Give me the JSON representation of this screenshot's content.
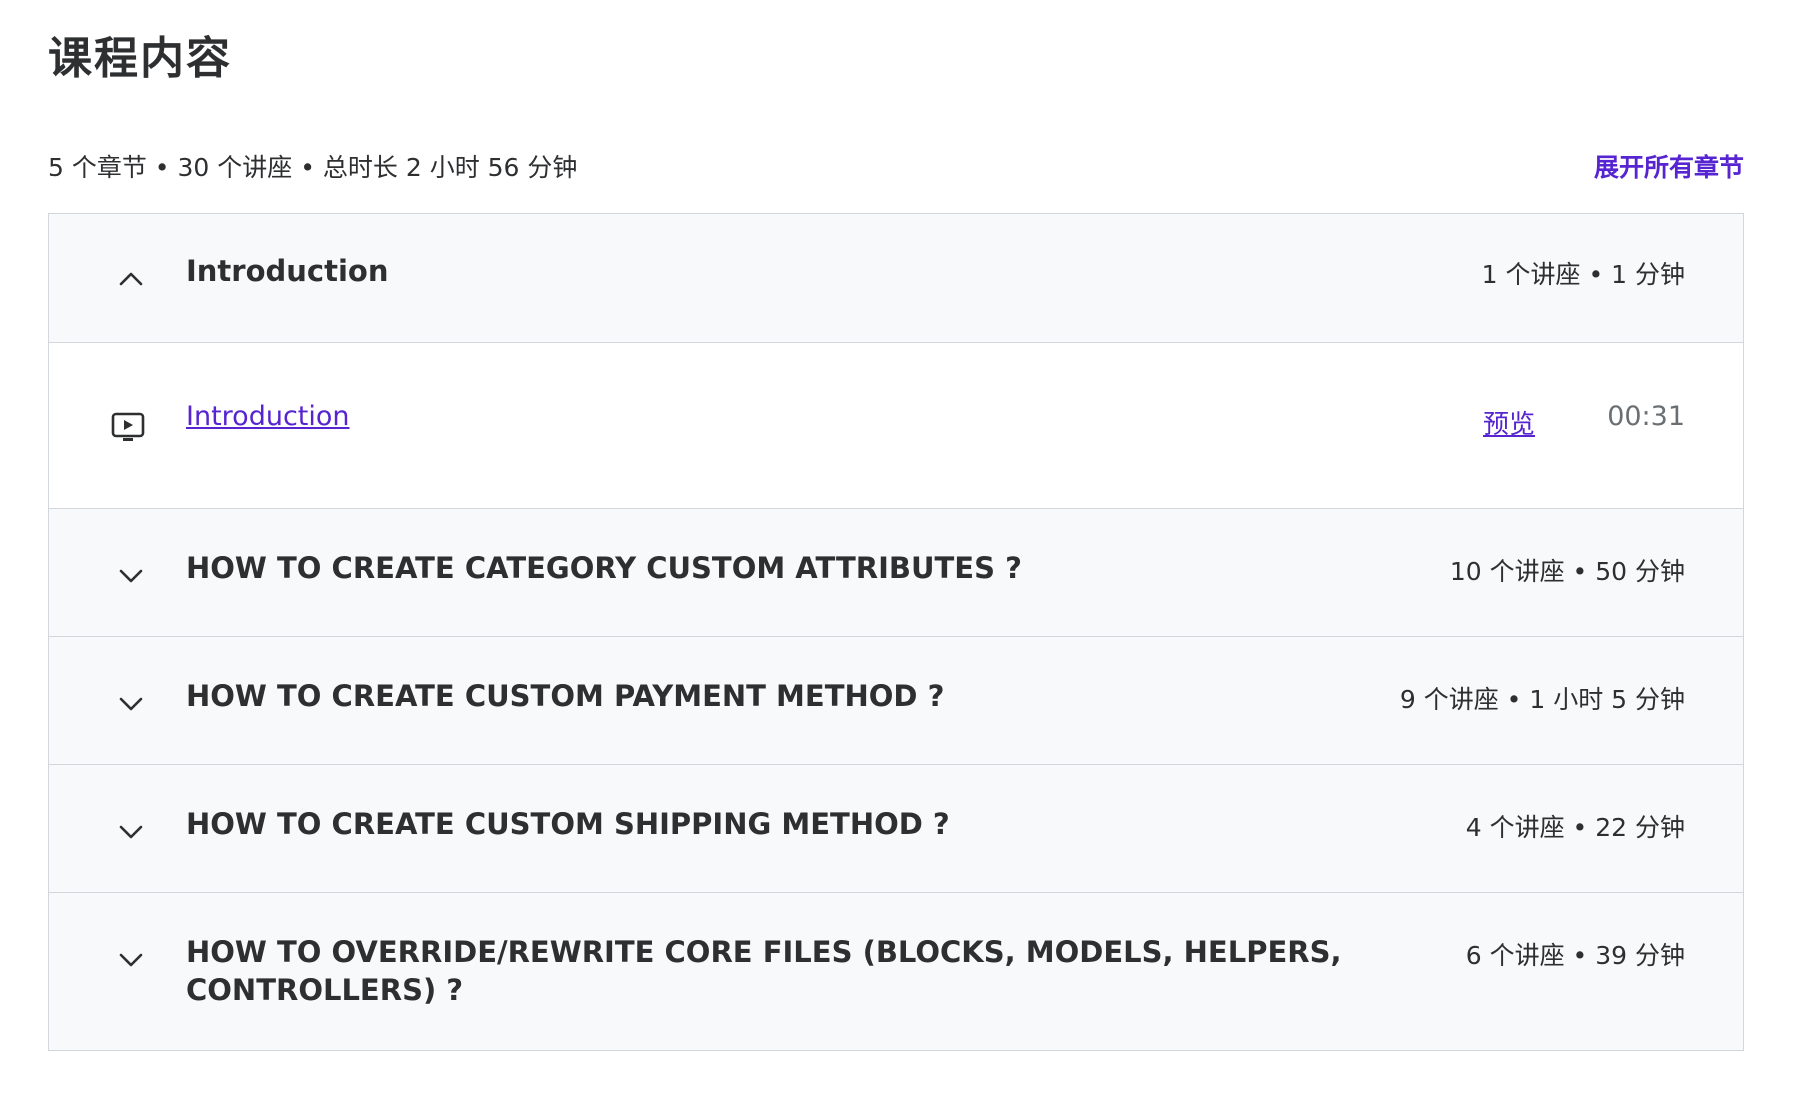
{
  "header": {
    "title": "课程内容",
    "summary": "5 个章节 • 30 个讲座 • 总时长 2 小时 56 分钟",
    "expand_all_label": "展开所有章节"
  },
  "colors": {
    "accent": "#5624d0",
    "text": "#2d2f31",
    "section_bg": "#f7f9fa",
    "border": "#d1d7dc"
  },
  "sections": [
    {
      "title": "Introduction",
      "meta": "1 个讲座 • 1 分钟",
      "expanded": true,
      "icon": "chevron-up-icon",
      "lectures": [
        {
          "title": "Introduction",
          "icon": "video-icon",
          "preview_label": "预览",
          "duration": "00:31"
        }
      ]
    },
    {
      "title": "HOW TO CREATE CATEGORY CUSTOM ATTRIBUTES ?",
      "meta": "10 个讲座 • 50 分钟",
      "expanded": false,
      "icon": "chevron-down-icon"
    },
    {
      "title": "HOW TO CREATE CUSTOM PAYMENT METHOD ?",
      "meta": "9 个讲座 • 1 小时 5 分钟",
      "expanded": false,
      "icon": "chevron-down-icon"
    },
    {
      "title": "HOW TO CREATE CUSTOM SHIPPING METHOD ?",
      "meta": "4 个讲座 • 22 分钟",
      "expanded": false,
      "icon": "chevron-down-icon"
    },
    {
      "title": "HOW TO OVERRIDE/REWRITE CORE FILES (BLOCKS, MODELS, HELPERS, CONTROLLERS) ?",
      "meta": "6 个讲座 • 39 分钟",
      "expanded": false,
      "icon": "chevron-down-icon"
    }
  ]
}
